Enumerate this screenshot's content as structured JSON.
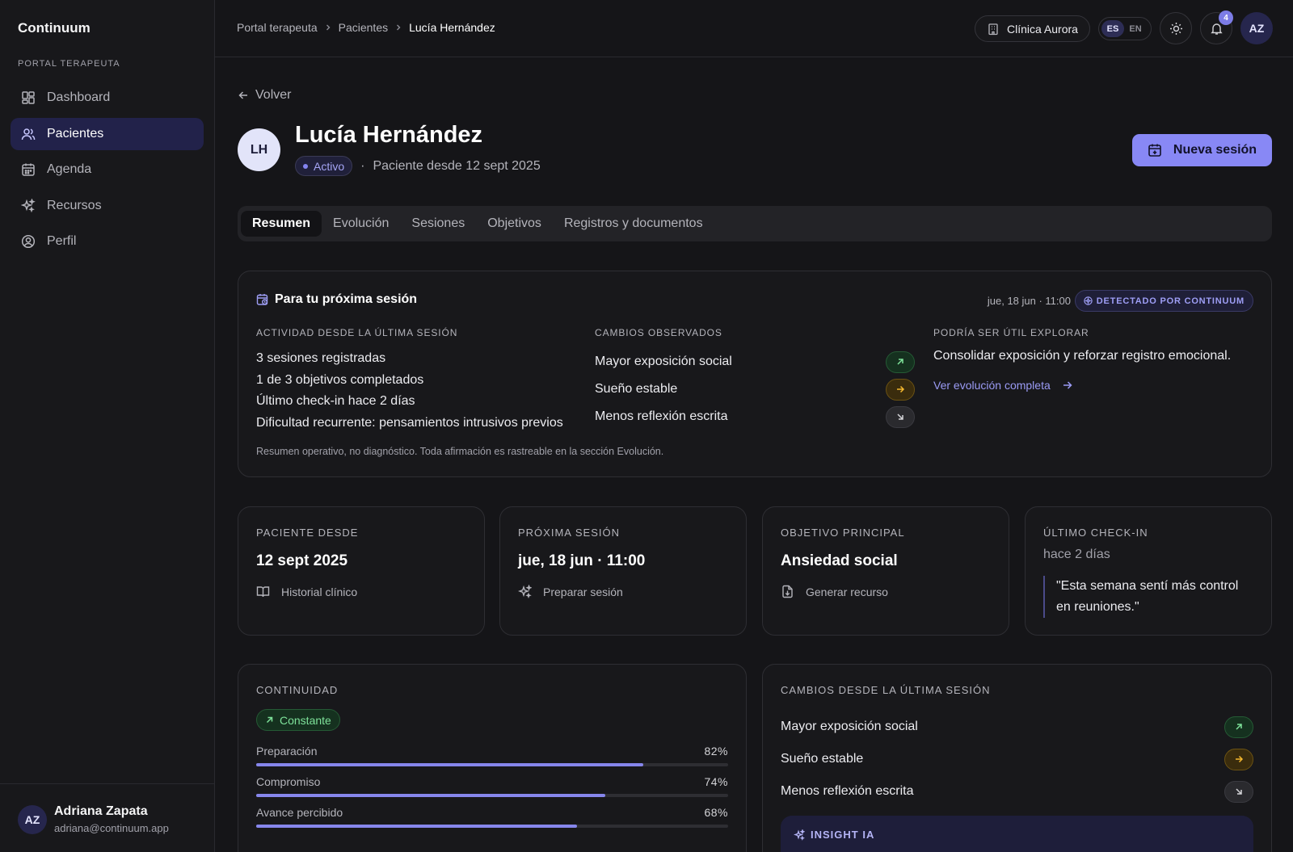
{
  "app": {
    "brand": "Continuum",
    "section_label": "PORTAL TERAPEUTA"
  },
  "sidebar": {
    "items": [
      {
        "label": "Dashboard",
        "icon": "dashboard-icon",
        "active": false
      },
      {
        "label": "Pacientes",
        "icon": "users-icon",
        "active": true
      },
      {
        "label": "Agenda",
        "icon": "calendar-icon",
        "active": false
      },
      {
        "label": "Recursos",
        "icon": "sparkles-icon",
        "active": false
      },
      {
        "label": "Perfil",
        "icon": "user-circle-icon",
        "active": false
      }
    ],
    "user": {
      "initials": "AZ",
      "name": "Adriana Zapata",
      "email": "adriana@continuum.app"
    }
  },
  "topbar": {
    "breadcrumbs": [
      "Portal terapeuta",
      "Pacientes",
      "Lucía Hernández"
    ],
    "clinic": "Clínica Aurora",
    "languages": [
      "ES",
      "EN"
    ],
    "active_language": "ES",
    "notifications_count": "4",
    "avatar_initials": "AZ"
  },
  "patient": {
    "back_label": "Volver",
    "initials": "LH",
    "name": "Lucía Hernández",
    "status": "Activo",
    "since_text": "Paciente desde 12 sept 2025",
    "new_session_label": "Nueva sesión"
  },
  "tabs": [
    "Resumen",
    "Evolución",
    "Sesiones",
    "Objetivos",
    "Registros y documentos"
  ],
  "next_session": {
    "title": "Para tu próxima sesión",
    "date": "jue, 18 jun · 11:00",
    "detected_badge": "DETECTADO POR CONTINUUM",
    "activity_heading": "ACTIVIDAD DESDE LA ÚLTIMA SESIÓN",
    "activity": [
      "3 sesiones registradas",
      "1 de 3 objetivos completados",
      "Último check-in hace 2 días",
      "Dificultad recurrente: pensamientos intrusivos previos"
    ],
    "changes_heading": "CAMBIOS OBSERVADOS",
    "changes": [
      {
        "label": "Mayor exposición social",
        "trend": "up"
      },
      {
        "label": "Sueño estable",
        "trend": "flat"
      },
      {
        "label": "Menos reflexión escrita",
        "trend": "down"
      }
    ],
    "explore_heading": "PODRÍA SER ÚTIL EXPLORAR",
    "explore_text": "Consolidar exposición y reforzar registro emocional.",
    "explore_link": "Ver evolución completa",
    "footnote": "Resumen operativo, no diagnóstico. Toda afirmación es rastreable en la sección Evolución."
  },
  "stats": [
    {
      "heading": "PACIENTE DESDE",
      "value": "12 sept 2025",
      "action": "Historial clínico",
      "icon": "book-icon"
    },
    {
      "heading": "PRÓXIMA SESIÓN",
      "value": "jue, 18 jun · 11:00",
      "action": "Preparar sesión",
      "icon": "sparkles-icon"
    },
    {
      "heading": "OBJETIVO PRINCIPAL",
      "value": "Ansiedad social",
      "action": "Generar recurso",
      "icon": "file-download-icon"
    },
    {
      "heading": "ÚLTIMO CHECK-IN",
      "sub": "hace 2 días",
      "quote": "\"Esta semana sentí más control en reuniones.\""
    }
  ],
  "continuity": {
    "heading": "CONTINUIDAD",
    "badge": "Constante",
    "bars": [
      {
        "label": "Preparación",
        "value_text": "82%",
        "value": 0.82
      },
      {
        "label": "Compromiso",
        "value_text": "74%",
        "value": 0.74
      },
      {
        "label": "Avance percibido",
        "value_text": "68%",
        "value": 0.68
      }
    ]
  },
  "changes_panel": {
    "heading": "CAMBIOS DESDE LA ÚLTIMA SESIÓN",
    "items": [
      {
        "label": "Mayor exposición social",
        "trend": "up"
      },
      {
        "label": "Sueño estable",
        "trend": "flat"
      },
      {
        "label": "Menos reflexión escrita",
        "trend": "down"
      }
    ],
    "insight_heading": "INSIGHT IA"
  },
  "colors": {
    "accent": "#8888f5",
    "up": "#7ee29a",
    "flat": "#f5b82e",
    "down": "#a1a1aa"
  }
}
